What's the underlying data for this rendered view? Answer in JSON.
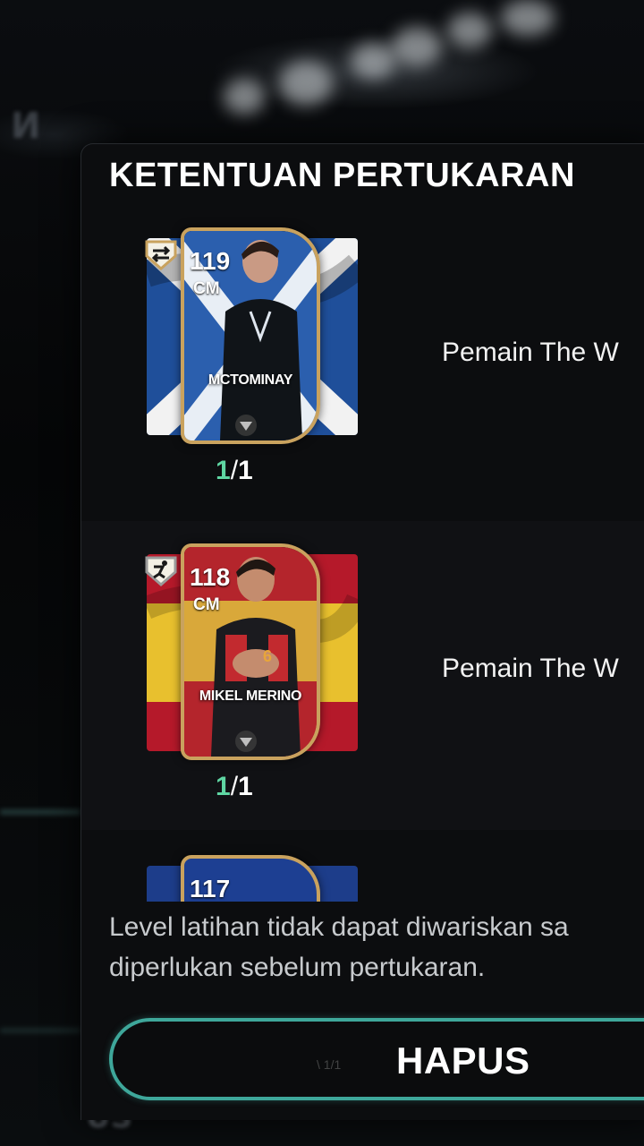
{
  "background": {
    "ghost_top": "И",
    "ghost_bottom": "US"
  },
  "panel": {
    "title": "KETENTUAN PERTUKARAN",
    "rows": [
      {
        "card": {
          "rating": "119",
          "position": "CM",
          "name": "MCTOMINAY",
          "flag": "scotland",
          "badge_icon": "swap-arrows-icon"
        },
        "count_have": "1",
        "count_sep": "/",
        "count_need": "1",
        "label": "Pemain The W"
      },
      {
        "card": {
          "rating": "118",
          "position": "CM",
          "name": "MIKEL MERINO",
          "flag": "spain",
          "badge_icon": "running-player-icon"
        },
        "count_have": "1",
        "count_sep": "/",
        "count_need": "1",
        "label": "Pemain The W"
      },
      {
        "card": {
          "rating": "117",
          "position": "",
          "name": "",
          "flag": "blue"
        }
      }
    ],
    "footer_line1": "Level latihan tidak dapat diwariskan sa",
    "footer_line2": "diperlukan sebelum pertukaran.",
    "button_label": "HAPUS",
    "button_ghost": "\\ 1/1"
  },
  "colors": {
    "accent_teal": "#3ea79a",
    "count_green": "#5fd6a3",
    "card_gold": "#c9a25e"
  }
}
